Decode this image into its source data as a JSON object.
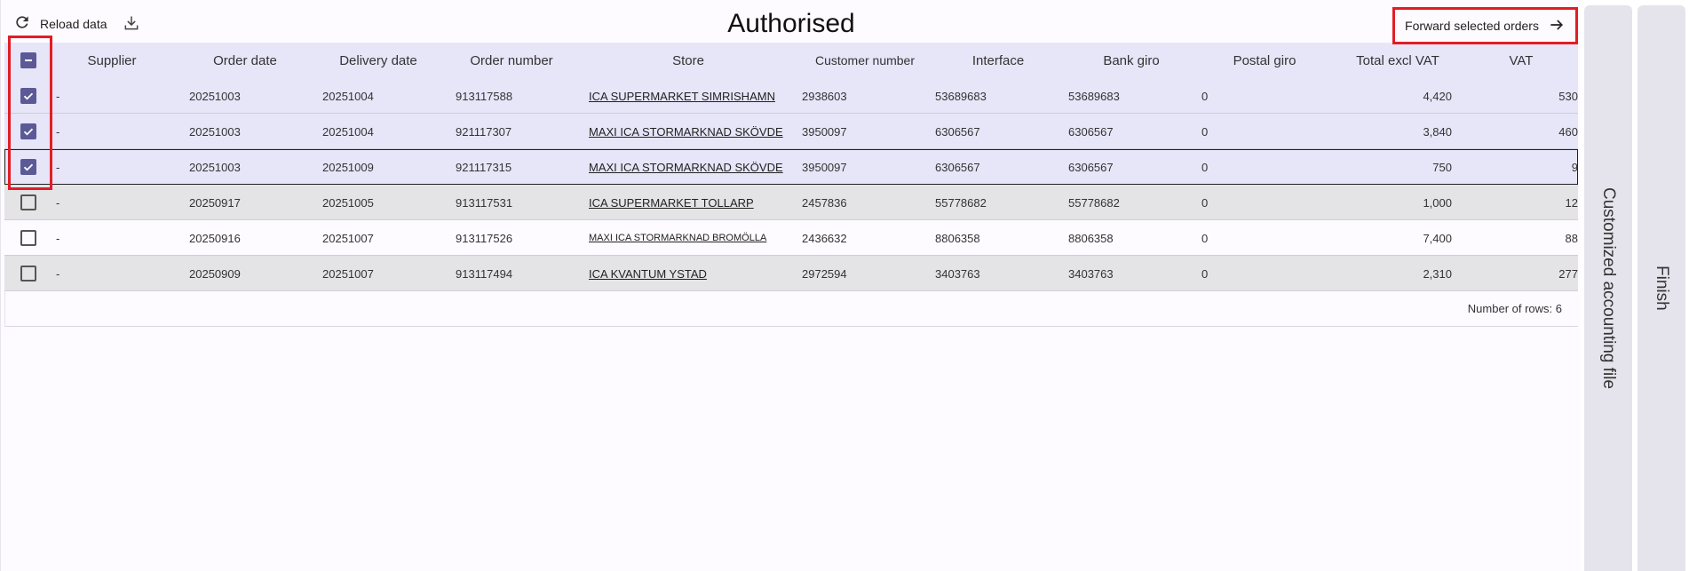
{
  "toolbar": {
    "reload_label": "Reload data",
    "title": "Authorised",
    "forward_label": "Forward selected orders"
  },
  "table": {
    "columns": [
      "Supplier",
      "Order date",
      "Delivery date",
      "Order number",
      "Store",
      "Customer number",
      "Interface",
      "Bank giro",
      "Postal giro",
      "Total excl VAT",
      "VAT"
    ],
    "rows": [
      {
        "supplier": "-",
        "order_date": "20251003",
        "delivery_date": "20251004",
        "order_number": "913117588",
        "store": "ICA SUPERMARKET SIMRISHAMN",
        "customer_number": "2938603",
        "interface": "53689683",
        "bank_giro": "53689683",
        "postal_giro": "0",
        "total_excl_vat": "4,420",
        "vat": "530"
      },
      {
        "supplier": "-",
        "order_date": "20251003",
        "delivery_date": "20251004",
        "order_number": "921117307",
        "store": "MAXI ICA STORMARKNAD SKÖVDE",
        "customer_number": "3950097",
        "interface": "6306567",
        "bank_giro": "6306567",
        "postal_giro": "0",
        "total_excl_vat": "3,840",
        "vat": "460"
      },
      {
        "supplier": "-",
        "order_date": "20251003",
        "delivery_date": "20251009",
        "order_number": "921117315",
        "store": "MAXI ICA STORMARKNAD SKÖVDE",
        "customer_number": "3950097",
        "interface": "6306567",
        "bank_giro": "6306567",
        "postal_giro": "0",
        "total_excl_vat": "750",
        "vat": "9"
      },
      {
        "supplier": "-",
        "order_date": "20250917",
        "delivery_date": "20251005",
        "order_number": "913117531",
        "store": "ICA SUPERMARKET TOLLARP",
        "customer_number": "2457836",
        "interface": "55778682",
        "bank_giro": "55778682",
        "postal_giro": "0",
        "total_excl_vat": "1,000",
        "vat": "12"
      },
      {
        "supplier": "-",
        "order_date": "20250916",
        "delivery_date": "20251007",
        "order_number": "913117526",
        "store": "MAXI ICA STORMARKNAD BROMÖLLA",
        "customer_number": "2436632",
        "interface": "8806358",
        "bank_giro": "8806358",
        "postal_giro": "0",
        "total_excl_vat": "7,400",
        "vat": "88"
      },
      {
        "supplier": "-",
        "order_date": "20250909",
        "delivery_date": "20251007",
        "order_number": "913117494",
        "store": "ICA KVANTUM YSTAD",
        "customer_number": "2972594",
        "interface": "3403763",
        "bank_giro": "3403763",
        "postal_giro": "0",
        "total_excl_vat": "2,310",
        "vat": "277"
      }
    ]
  },
  "footer": {
    "row_count_label": "Number of rows: 6"
  },
  "side_tabs": {
    "accounting": "Customized accounting file",
    "finish": "Finish"
  },
  "colors": {
    "accent": "#5b5996",
    "selected_row": "#e7e5f8",
    "highlight_box": "#e11d25"
  }
}
